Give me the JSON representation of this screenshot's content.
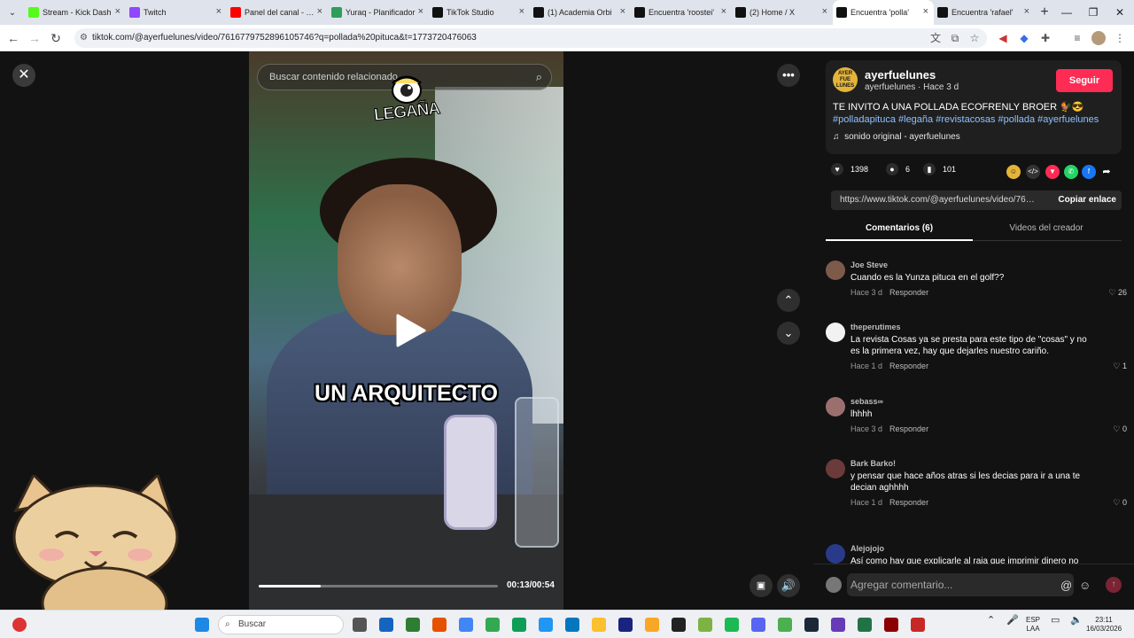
{
  "browser": {
    "tabs": [
      {
        "title": "Stream - Kick Dash",
        "color": "#53fc18"
      },
      {
        "title": "Twitch",
        "color": "#9146ff"
      },
      {
        "title": "Panel del canal - YouTube",
        "color": "#ff0000"
      },
      {
        "title": "Yuraq - Planificador",
        "color": "#2e9e5b"
      },
      {
        "title": "TikTok Studio",
        "color": "#111111"
      },
      {
        "title": "(1) Academia Orbi",
        "color": "#111111"
      },
      {
        "title": "Encuentra 'roostei'",
        "color": "#111111"
      },
      {
        "title": "(2) Home / X",
        "color": "#111111"
      },
      {
        "title": "Encuentra 'polla'",
        "color": "#111111"
      },
      {
        "title": "Encuentra 'rafael'",
        "color": "#111111"
      }
    ],
    "url": "tiktok.com/@ayerfuelunes/video/7616779752896105746?q=pollada%20pituca&t=1773720476063"
  },
  "player": {
    "search_placeholder": "Buscar contenido relacionado",
    "logo_text": "LEGAÑA",
    "caption": "UN ARQUITECTO",
    "timecode": "00:13/00:54",
    "progress": 0.26
  },
  "post": {
    "avatar_text": "AYER FUE LUNES",
    "username": "ayerfuelunes",
    "subline": "ayerfuelunes · Hace 3 d",
    "follow_label": "Seguir",
    "description": "TE INVITO A UNA POLLADA ECOFRENLY BROER 🐓😎",
    "hashtags": "#polladapituca #legaña #revistacosas #pollada #ayerfuelunes",
    "sound": "sonido original - ayerfuelunes",
    "likes": "1398",
    "comments": "6",
    "saves": "101",
    "link": "https://www.tiktok.com/@ayerfuelunes/video/7616...",
    "copy_label": "Copiar enlace",
    "tab_comments": "Comentarios (6)",
    "tab_videos": "Videos del creador"
  },
  "comments": [
    {
      "name": "Joe Steve",
      "text": "Cuando es la Yunza pituca en el golf??",
      "time": "Hace 3 d",
      "reply": "Responder",
      "likes": "26",
      "color": "#7d5a4a"
    },
    {
      "name": "theperutimes",
      "text": "La revista Cosas ya se presta para este tipo de \"cosas\" y no es la primera vez, hay que dejarles nuestro cariño.",
      "time": "Hace 1 d",
      "reply": "Responder",
      "likes": "1",
      "color": "#f2f2f2"
    },
    {
      "name": "sebass∞",
      "text": "lhhhh",
      "time": "Hace 3 d",
      "reply": "Responder",
      "likes": "0",
      "color": "#9c6f6f"
    },
    {
      "name": "Bark Barko!",
      "text": "y pensar que hace años atras si les decias para ir a una te decian aghhhh",
      "time": "Hace 1 d",
      "reply": "Responder",
      "likes": "0",
      "color": "#6b3a3a"
    },
    {
      "name": "Alejojojo",
      "text": "Así como hay que explicarle al raja que imprimir dinero no",
      "time": "",
      "reply": "",
      "likes": "",
      "color": "#2a3a8a"
    }
  ],
  "composer": {
    "placeholder": "Agregar comentario..."
  },
  "taskbar": {
    "search": "Buscar",
    "lang_top": "ESP",
    "lang_bottom": "LAA",
    "time": "23:11",
    "date": "16/03/2026"
  }
}
